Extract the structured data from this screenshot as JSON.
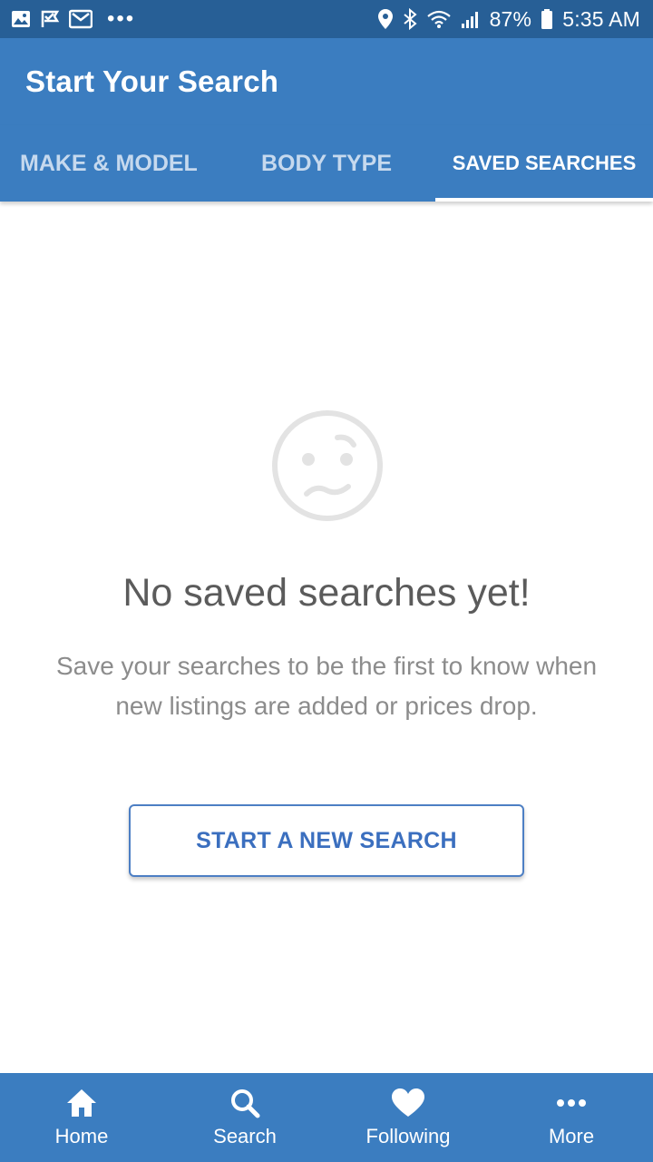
{
  "status_bar": {
    "battery": "87%",
    "time": "5:35 AM",
    "overflow": "•••",
    "icons_left": [
      "image-icon",
      "check-flag-icon",
      "gmail-icon"
    ],
    "icons_right": [
      "location-pin-icon",
      "bluetooth-icon",
      "wifi-icon",
      "signal-icon",
      "battery-icon"
    ]
  },
  "app_bar": {
    "title": "Start Your Search"
  },
  "tabs": [
    {
      "label": "MAKE & MODEL",
      "active": false
    },
    {
      "label": "BODY TYPE",
      "active": false
    },
    {
      "label": "SAVED SEARCHES",
      "active": true
    }
  ],
  "empty_state": {
    "icon": "confused-face-icon",
    "title": "No saved searches yet!",
    "description": "Save your searches to be the first to know when new listings are added or prices drop.",
    "button_label": "START A NEW SEARCH"
  },
  "bottom_nav": [
    {
      "label": "Home",
      "icon": "home-icon"
    },
    {
      "label": "Search",
      "icon": "search-icon"
    },
    {
      "label": "Following",
      "icon": "heart-icon"
    },
    {
      "label": "More",
      "icon": "more-dots-icon"
    }
  ],
  "colors": {
    "status_bar": "#275f96",
    "primary": "#3b7dc0",
    "button_text": "#3b6fbf",
    "title_text": "#5b5b5b",
    "body_text": "#8c8c8c",
    "face_icon": "#e3e3e3"
  }
}
